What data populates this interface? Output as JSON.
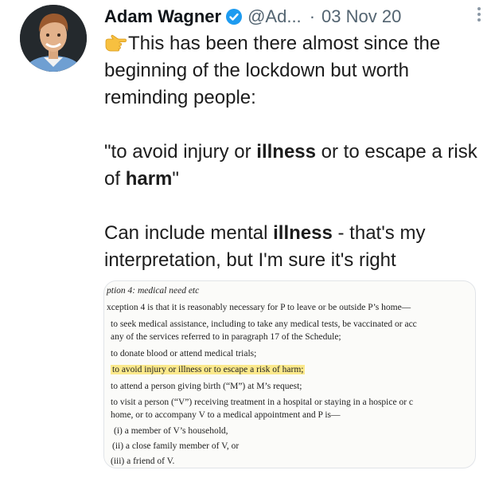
{
  "tweet": {
    "author_name": "Adam Wagner",
    "handle": "@Ad...",
    "separator": "·",
    "date": "03 Nov 20",
    "text_line_1": "This has been there almost since the beginning of the lockdown but worth reminding people:",
    "quote_prefix": "\"to avoid injury or ",
    "quote_bold_1": "illness",
    "quote_mid": " or to escape a risk of ",
    "quote_bold_2": "harm",
    "quote_suffix": "\"",
    "note_prefix": "Can include mental ",
    "note_bold": "illness",
    "note_suffix": " - that's my interpretation, but I'm sure it's right"
  },
  "icons": {
    "verified": "verified-badge-icon",
    "pointing": "pointing-right-hand-icon",
    "more": "more-options-icon"
  },
  "colors": {
    "verified_blue": "#1d9bf0",
    "highlight": "#fbe98c",
    "handle_gray": "#536471"
  },
  "media": {
    "heading": "ption 4: medical need etc",
    "intro": "xception 4 is that it is reasonably necessary for P to leave or be outside P’s home—",
    "items": [
      "to seek medical assistance, including to take any medical tests, be vaccinated or acc",
      "any of the services referred to in paragraph 17 of the Schedule;",
      "to donate blood or attend medical trials;",
      "to avoid injury or illness or to escape a risk of harm;",
      "to attend a person giving birth (“M”) at M’s request;",
      "to visit a person (“V”) receiving treatment in a hospital or staying in a hospice or c",
      "home, or to accompany V to a medical appointment and P is—"
    ],
    "subitems": [
      "(i)  a member of V’s household,",
      "(ii)  a close family member of V, or",
      "(iii)  a friend of V."
    ]
  }
}
